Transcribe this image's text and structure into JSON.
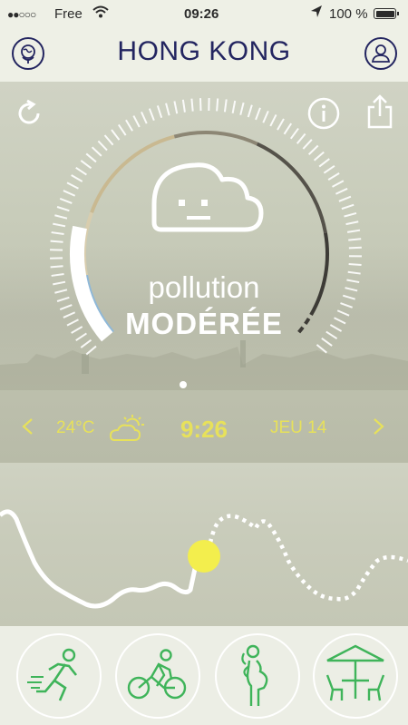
{
  "status_bar": {
    "signal": "●●○○○",
    "carrier": "Free",
    "time": "09:26",
    "battery": "100 %"
  },
  "header": {
    "city": "HONG KONG",
    "left_icon": "globe-pin-icon",
    "right_icon": "user-profile-icon"
  },
  "hero": {
    "pollution_label": "pollution",
    "pollution_level": "MODÉRÉE",
    "face": "neutral-cloud-face-icon",
    "pollution_level_value": 0.2
  },
  "weather": {
    "prev": "<",
    "temperature": "24°C",
    "weather_icon": "sun-behind-cloud-icon",
    "clock": "9:26",
    "day": "JEU 14",
    "next": ">"
  },
  "activities": [
    {
      "name": "running",
      "icon": "runner-icon"
    },
    {
      "name": "cycling",
      "icon": "cyclist-icon"
    },
    {
      "name": "pregnancy",
      "icon": "pregnant-woman-icon"
    },
    {
      "name": "terrace",
      "icon": "terrace-table-icon"
    }
  ],
  "colors": {
    "accent_text": "#232560",
    "highlight_yellow": "#f3ee4d",
    "activity_green": "#3fb45a"
  }
}
